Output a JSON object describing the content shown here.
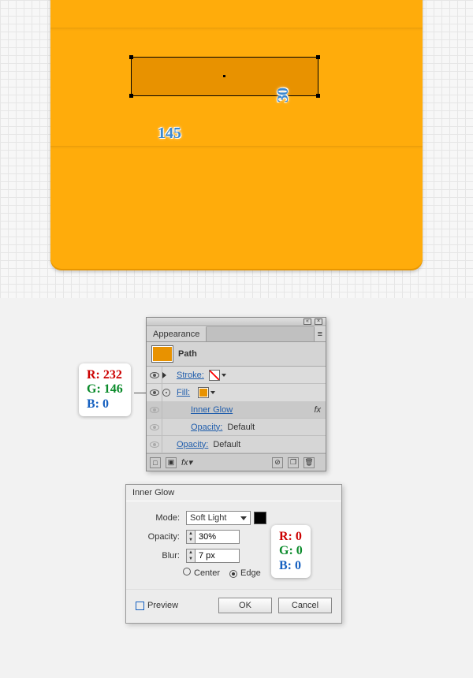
{
  "artboard": {
    "width_label": "145",
    "height_label": "30"
  },
  "fill_color_callout": {
    "r": "R: 232",
    "g": "G: 146",
    "b": "B: 0"
  },
  "appearance_panel": {
    "tab": "Appearance",
    "object_type": "Path",
    "stroke_label": "Stroke:",
    "fill_label": "Fill:",
    "effect_name": "Inner Glow",
    "opacity_label": "Opacity:",
    "opacity_value_default": "Default"
  },
  "dialog": {
    "title": "Inner Glow",
    "mode_label": "Mode:",
    "mode_value": "Soft Light",
    "opacity_label": "Opacity:",
    "opacity_value": "30%",
    "blur_label": "Blur:",
    "blur_value": "7 px",
    "center_label": "Center",
    "edge_label": "Edge",
    "preview_label": "Preview",
    "ok_label": "OK",
    "cancel_label": "Cancel"
  },
  "glow_color_callout": {
    "r": "R: 0",
    "g": "G: 0",
    "b": "B: 0"
  }
}
